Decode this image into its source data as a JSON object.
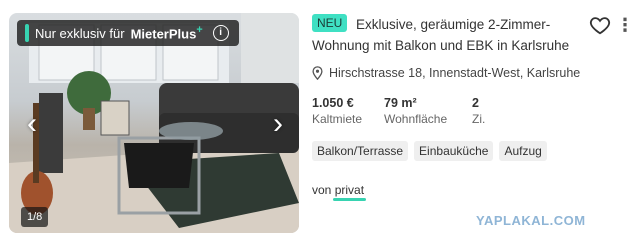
{
  "listing": {
    "badge": {
      "text_before": "Nur exklusiv für ",
      "brand": "Mieter",
      "brand_suffix": "Plus",
      "plus_sign": "+",
      "info": "i"
    },
    "gallery": {
      "prev": "‹",
      "next": "›",
      "counter": "1/8"
    },
    "new_label": "NEU",
    "title": "Exklusive, geräumige 2-Zimmer-Wohnung mit Balkon und EBK in Karlsruhe",
    "more_icon": "⋮",
    "address": "Hirschstrasse 18, Innenstadt-West, Karlsruhe",
    "facts": [
      {
        "value": "1.050 €",
        "label": "Kaltmiete"
      },
      {
        "value": "79 m²",
        "label": "Wohnfläche"
      },
      {
        "value": "2",
        "label": "Zi."
      }
    ],
    "tags": [
      "Balkon/Terrasse",
      "Einbauküche",
      "Aufzug"
    ],
    "vendor_prefix": "von ",
    "vendor": "privat"
  },
  "watermark": "YAPLAKAL.COM",
  "colors": {
    "accent": "#3fe0c3",
    "badge_bg": "#1e1e1e",
    "tag_bg": "#efefef"
  }
}
